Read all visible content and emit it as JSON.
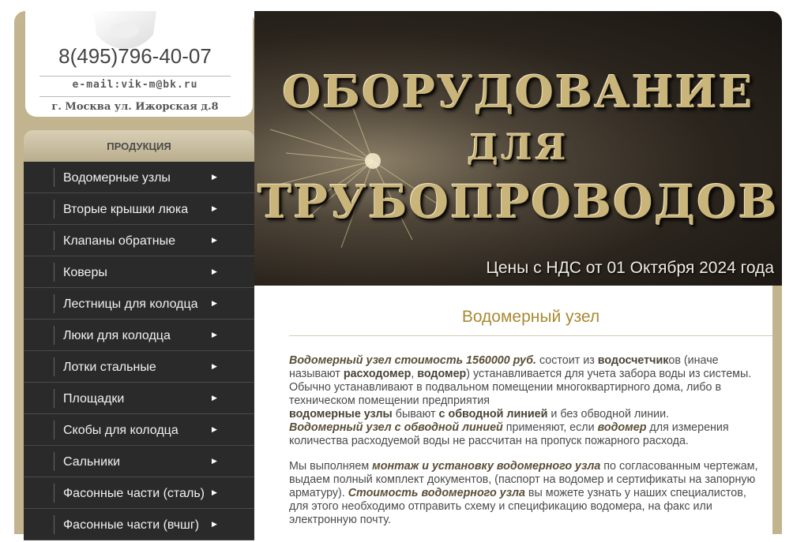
{
  "contact": {
    "phone": "8(495)796-40-07",
    "email": "e-mail:vik-m@bk.ru",
    "address": "г. Москва ул. Ижорская д.8"
  },
  "menu": {
    "header": "ПРОДУКЦИЯ",
    "items": [
      {
        "label": "Водомерные узлы"
      },
      {
        "label": "Вторые крышки люка"
      },
      {
        "label": "Клапаны обратные"
      },
      {
        "label": "Коверы"
      },
      {
        "label": "Лестницы для колодца"
      },
      {
        "label": "Люки для колодца"
      },
      {
        "label": "Лотки стальные"
      },
      {
        "label": "Площадки"
      },
      {
        "label": "Скобы для колодца"
      },
      {
        "label": "Сальники"
      },
      {
        "label": "Фасонные части (сталь)"
      },
      {
        "label": "Фасонные части (вчшг)"
      }
    ],
    "arrow_icon": "triangle-right-icon"
  },
  "banner": {
    "line1": "ОБОРУДОВАНИЕ",
    "line2": "ДЛЯ",
    "line3": "ТРУБОПРОВОДОВ",
    "price_note": "Цены с НДС от 01 Октября 2024 года"
  },
  "content": {
    "title": "Водомерный узел",
    "p1": {
      "s1": "Водомерный узел стоимость 1560000 руб.",
      "s2": " состоит из ",
      "s3": "водосчетчик",
      "s4": "ов (иначе называют ",
      "s5": "расходомер",
      "s6": ", ",
      "s7": "водомер",
      "s8": ") устанавливается для учета забора воды из системы. Обычно устанавливают в подвальном помещении многоквартирного дома, либо в техническом помещении предприятия",
      "s9": "водомерные узлы",
      "s10": " бывают ",
      "s11": "с обводной линией",
      "s12": " и без обводной линии.",
      "s13": "Водомерный узел с обводной линией",
      "s14": " применяют, если ",
      "s15": "водомер",
      "s16": " для измерения количества расходуемой воды не рассчитан на пропуск пожарного расхода."
    },
    "p2": {
      "s1": "Мы выполняем ",
      "s2": "монтаж и установку водомерного узла",
      "s3": " по согласованным чертежам, выдаем полный комплект документов, (паспорт на водомер и сертификаты на запорную арматуру). ",
      "s4": "Стоимость водомерного узла",
      "s5": " вы можете узнать у наших специалистов, для этого необходимо отправить схему и спецификацию водомера, на факс или электронную почту."
    }
  },
  "colors": {
    "tan": "#c2b48e",
    "menu_bg": "#2a2a2a",
    "title_gold": "#a88a32"
  }
}
